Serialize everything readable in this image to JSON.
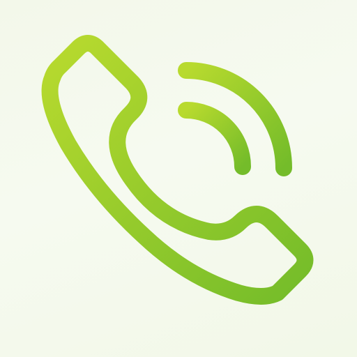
{
  "icon": {
    "name": "phone-call-icon",
    "background_color": "#f4f9ec",
    "stroke_gradient": {
      "start": "#b8da2e",
      "end": "#74bc2a"
    }
  }
}
